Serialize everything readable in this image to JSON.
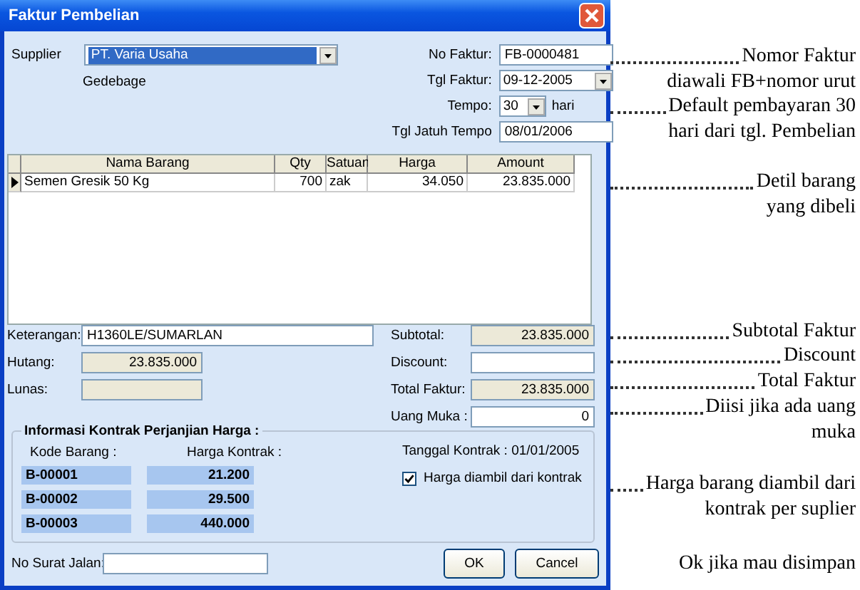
{
  "window": {
    "title": "Faktur Pembelian"
  },
  "supplier": {
    "label": "Supplier",
    "value": "PT. Varia Usaha",
    "address": "Gedebage"
  },
  "invoice_fields": [
    {
      "label": "No Faktur:",
      "value": "FB-0000481",
      "kind": "text"
    },
    {
      "label": "Tgl Faktur:",
      "value": "09-12-2005",
      "kind": "dropdown"
    },
    {
      "label": "Tempo:",
      "value": "30",
      "suffix": "hari",
      "kind": "short_dropdown"
    },
    {
      "label": "Tgl Jatuh Tempo",
      "value": "08/01/2006",
      "kind": "text"
    }
  ],
  "table": {
    "columns": [
      "Nama Barang",
      "Qty",
      "Satuan",
      "Harga",
      "Amount"
    ],
    "rows": [
      {
        "selected": true,
        "cells": [
          "Semen Gresik 50 Kg",
          "700",
          "zak",
          "34.050",
          "23.835.000"
        ]
      }
    ]
  },
  "left_fields": [
    {
      "label": "Keterangan:",
      "value": "H1360LE/SUMARLAN",
      "readonly": false
    },
    {
      "label": "Hutang:",
      "value": "23.835.000",
      "readonly": true
    },
    {
      "label": "Lunas:",
      "readonly": true
    }
  ],
  "totals": [
    {
      "label": "Subtotal:",
      "value": "23.835.000",
      "readonly": true
    },
    {
      "label": "Discount:",
      "readonly": false
    },
    {
      "label": "Total Faktur:",
      "value": "23.835.000",
      "readonly": true
    },
    {
      "label": "Uang Muka :",
      "value": "0",
      "readonly": false
    }
  ],
  "contract": {
    "title": "Informasi Kontrak Perjanjian Harga :",
    "code_header": "Kode Barang :",
    "price_header": "Harga Kontrak :",
    "rows": [
      {
        "code": "B-00001",
        "price": "21.200"
      },
      {
        "code": "B-00002",
        "price": "29.500"
      },
      {
        "code": "B-00003",
        "price": "440.000"
      }
    ],
    "date": "Tanggal Kontrak : 01/01/2005",
    "checkbox": {
      "label": "Harga diambil dari kontrak",
      "checked": true
    }
  },
  "delivery_note": {
    "label": "No Surat Jalan:"
  },
  "buttons": [
    "OK",
    "Cancel"
  ],
  "notes": [
    {
      "leader": true,
      "lines": [
        "Nomor Faktur",
        "diawali FB+nomor urut"
      ]
    },
    {
      "leader": true,
      "lines": [
        "Default pembayaran 30",
        "hari dari tgl. Pembelian"
      ]
    },
    {
      "leader": true,
      "lines": [
        "Detil barang",
        "yang dibeli"
      ]
    },
    {
      "leader": true,
      "lines": [
        "Subtotal Faktur"
      ]
    },
    {
      "leader": true,
      "lines": [
        "Discount"
      ]
    },
    {
      "leader": true,
      "lines": [
        "Total Faktur"
      ]
    },
    {
      "leader": true,
      "lines": [
        "Diisi jika ada uang",
        "muka"
      ]
    },
    {
      "leader": true,
      "lines": [
        "Harga barang diambil dari",
        "kontrak per suplier"
      ]
    },
    {
      "leader": false,
      "lines": [
        "Ok jika mau disimpan"
      ]
    }
  ]
}
